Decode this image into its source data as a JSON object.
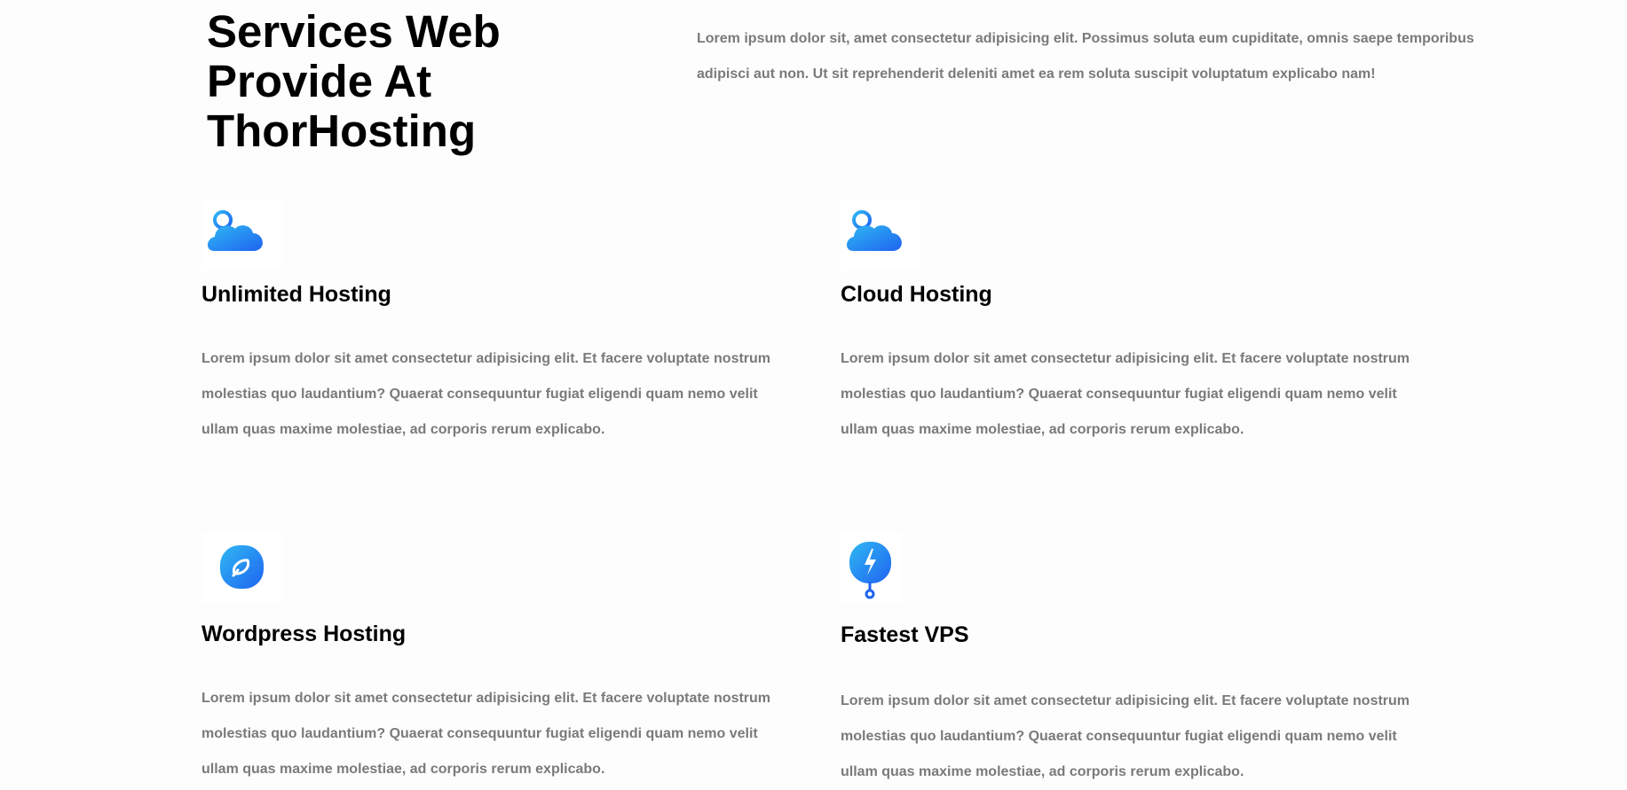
{
  "section": {
    "heading": "Services Web Provide At ThorHosting",
    "intro": "Lorem ipsum dolor sit, amet consectetur adipisicing elit. Possimus soluta eum cupiditate, omnis saepe temporibus adipisci aut non. Ut sit reprehenderit deleniti amet ea rem soluta suscipit voluptatum explicabo nam!"
  },
  "services": [
    {
      "icon": "cloud-icon",
      "title": "Unlimited Hosting",
      "description": "Lorem ipsum dolor sit amet consectetur adipisicing elit. Et facere voluptate nostrum molestias quo laudantium? Quaerat consequuntur fugiat eligendi quam nemo velit ullam quas maxime molestiae, ad corporis rerum explicabo."
    },
    {
      "icon": "cloud-icon",
      "title": "Cloud Hosting",
      "description": "Lorem ipsum dolor sit amet consectetur adipisicing elit. Et facere voluptate nostrum molestias quo laudantium? Quaerat consequuntur fugiat eligendi quam nemo velit ullam quas maxime molestiae, ad corporis rerum explicabo."
    },
    {
      "icon": "wordpress-leaf-icon",
      "title": "Wordpress Hosting",
      "description": "Lorem ipsum dolor sit amet consectetur adipisicing elit. Et facere voluptate nostrum molestias quo laudantium? Quaerat consequuntur fugiat eligendi quam nemo velit ullam quas maxime molestiae, ad corporis rerum explicabo."
    },
    {
      "icon": "lightning-pin-icon",
      "title": "Fastest VPS",
      "description": "Lorem ipsum dolor sit amet consectetur adipisicing elit. Et facere voluptate nostrum molestias quo laudantium? Quaerat consequuntur fugiat eligendi quam nemo velit ullam quas maxime molestiae, ad corporis rerum explicabo."
    }
  ],
  "colors": {
    "heading": "#000000",
    "body_text": "#7a7a7a",
    "icon_gradient_start": "#2fb8f3",
    "icon_gradient_end": "#1f63f0"
  }
}
